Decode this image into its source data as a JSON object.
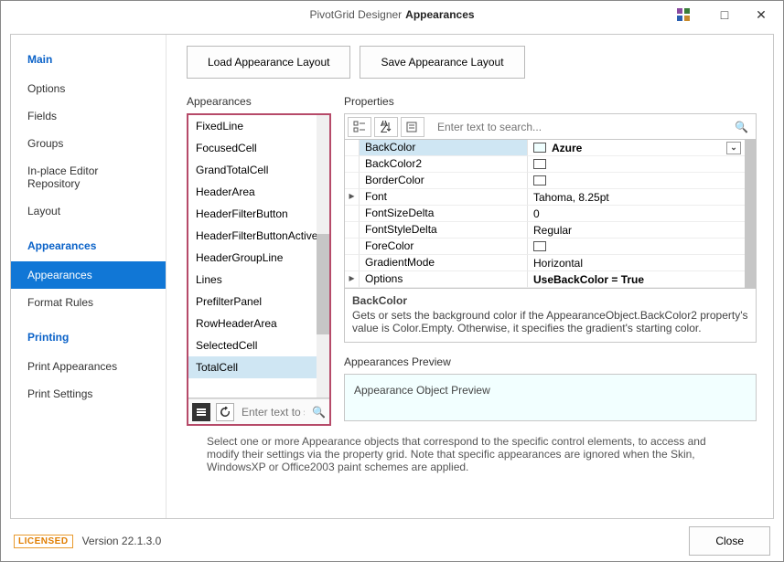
{
  "window": {
    "title_light": "PivotGrid Designer",
    "title_bold": "Appearances"
  },
  "buttons": {
    "load": "Load Appearance Layout",
    "save": "Save Appearance Layout",
    "close": "Close"
  },
  "sidebar": {
    "sections": [
      {
        "header": "Main",
        "items": [
          "Options",
          "Fields",
          "Groups",
          "In-place Editor Repository",
          "Layout"
        ]
      },
      {
        "header": "Appearances",
        "items": [
          "Appearances",
          "Format Rules"
        ],
        "selected": 0
      },
      {
        "header": "Printing",
        "items": [
          "Print Appearances",
          "Print Settings"
        ]
      }
    ]
  },
  "appearances": {
    "header": "Appearances",
    "items": [
      "FixedLine",
      "FocusedCell",
      "GrandTotalCell",
      "HeaderArea",
      "HeaderFilterButton",
      "HeaderFilterButtonActive",
      "HeaderGroupLine",
      "Lines",
      "PrefilterPanel",
      "RowHeaderArea",
      "SelectedCell",
      "TotalCell"
    ],
    "selected": "TotalCell",
    "search_placeholder": "Enter text to s"
  },
  "properties": {
    "header": "Properties",
    "search_placeholder": "Enter text to search...",
    "rows": [
      {
        "name": "BackColor",
        "value": "Azure",
        "swatch": "azure",
        "expander": "",
        "selected": true,
        "dropdown": true
      },
      {
        "name": "BackColor2",
        "value": "",
        "swatch": "white",
        "expander": ""
      },
      {
        "name": "BorderColor",
        "value": "",
        "swatch": "white",
        "expander": ""
      },
      {
        "name": "Font",
        "value": "Tahoma, 8.25pt",
        "expander": "▸"
      },
      {
        "name": "FontSizeDelta",
        "value": "0",
        "expander": ""
      },
      {
        "name": "FontStyleDelta",
        "value": "Regular",
        "expander": ""
      },
      {
        "name": "ForeColor",
        "value": "",
        "swatch": "white",
        "expander": ""
      },
      {
        "name": "GradientMode",
        "value": "Horizontal",
        "expander": ""
      },
      {
        "name": "Options",
        "value": "UseBackColor = True",
        "expander": "▸",
        "bold": true
      }
    ],
    "desc_title": "BackColor",
    "desc_text": "Gets or sets the background color if the AppearanceObject.BackColor2 property's value is Color.Empty. Otherwise, it specifies the gradient's starting color."
  },
  "preview": {
    "header": "Appearances Preview",
    "text": "Appearance Object Preview"
  },
  "note": "Select one or more Appearance objects that correspond to the specific control elements, to access and modify their settings via the property grid. Note that specific appearances are ignored when the Skin, WindowsXP or Office2003 paint schemes are applied.",
  "footer": {
    "licensed": "LICENSED",
    "version": "Version 22.1.3.0"
  }
}
